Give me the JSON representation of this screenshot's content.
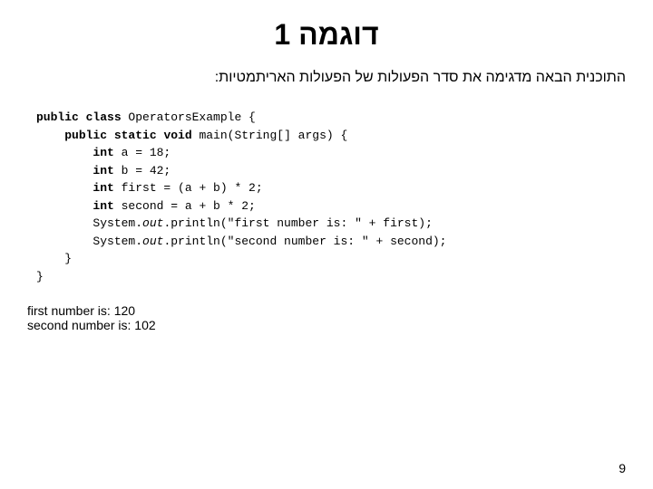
{
  "title": "דוגמה 1",
  "subtitle": "התוכנית הבאה מדגימה את סדר הפעולות של הפעולות האריתמטיות:",
  "code": {
    "lines": [
      {
        "text": "public class OperatorsExample {",
        "parts": [
          {
            "t": "public ",
            "style": "kw"
          },
          {
            "t": "class ",
            "style": "kw"
          },
          {
            "t": "OperatorsExample {",
            "style": "normal"
          }
        ]
      },
      {
        "text": "    public static void main(String[] args) {",
        "parts": [
          {
            "t": "    ",
            "style": "normal"
          },
          {
            "t": "public ",
            "style": "kw"
          },
          {
            "t": "static ",
            "style": "kw"
          },
          {
            "t": "void ",
            "style": "kw"
          },
          {
            "t": "main(String[] args) {",
            "style": "normal"
          }
        ]
      },
      {
        "text": "        int a = 18;",
        "parts": [
          {
            "t": "        ",
            "style": "normal"
          },
          {
            "t": "int",
            "style": "kw"
          },
          {
            "t": " a = 18;",
            "style": "normal"
          }
        ]
      },
      {
        "text": "        int b = 42;",
        "parts": [
          {
            "t": "        ",
            "style": "normal"
          },
          {
            "t": "int",
            "style": "kw"
          },
          {
            "t": " b = 42;",
            "style": "normal"
          }
        ]
      },
      {
        "text": "        int first = (a + b) * 2;",
        "parts": [
          {
            "t": "        ",
            "style": "normal"
          },
          {
            "t": "int",
            "style": "kw"
          },
          {
            "t": " first = (a + b) * 2;",
            "style": "normal"
          }
        ]
      },
      {
        "text": "        int second = a + b * 2;",
        "parts": [
          {
            "t": "        ",
            "style": "normal"
          },
          {
            "t": "int",
            "style": "kw"
          },
          {
            "t": " second = a + b * 2;",
            "style": "normal"
          }
        ]
      },
      {
        "text": "        System.out.println(\"first number is: \" + first);",
        "parts": [
          {
            "t": "        System.",
            "style": "normal"
          },
          {
            "t": "out",
            "style": "italic"
          },
          {
            "t": ".println(\"first number is: \" + first);",
            "style": "normal"
          }
        ]
      },
      {
        "text": "        System.out.println(\"second number is: \" + second);",
        "parts": [
          {
            "t": "        System.",
            "style": "normal"
          },
          {
            "t": "out",
            "style": "italic"
          },
          {
            "t": ".println(\"second number is: \" + second);",
            "style": "normal"
          }
        ]
      },
      {
        "text": "    }",
        "parts": [
          {
            "t": "    }",
            "style": "normal"
          }
        ]
      },
      {
        "text": "}",
        "parts": [
          {
            "t": "}",
            "style": "normal"
          }
        ]
      }
    ]
  },
  "output": {
    "line1": "first number is: 120",
    "line2": "second number is: 102"
  },
  "page_number": "9"
}
